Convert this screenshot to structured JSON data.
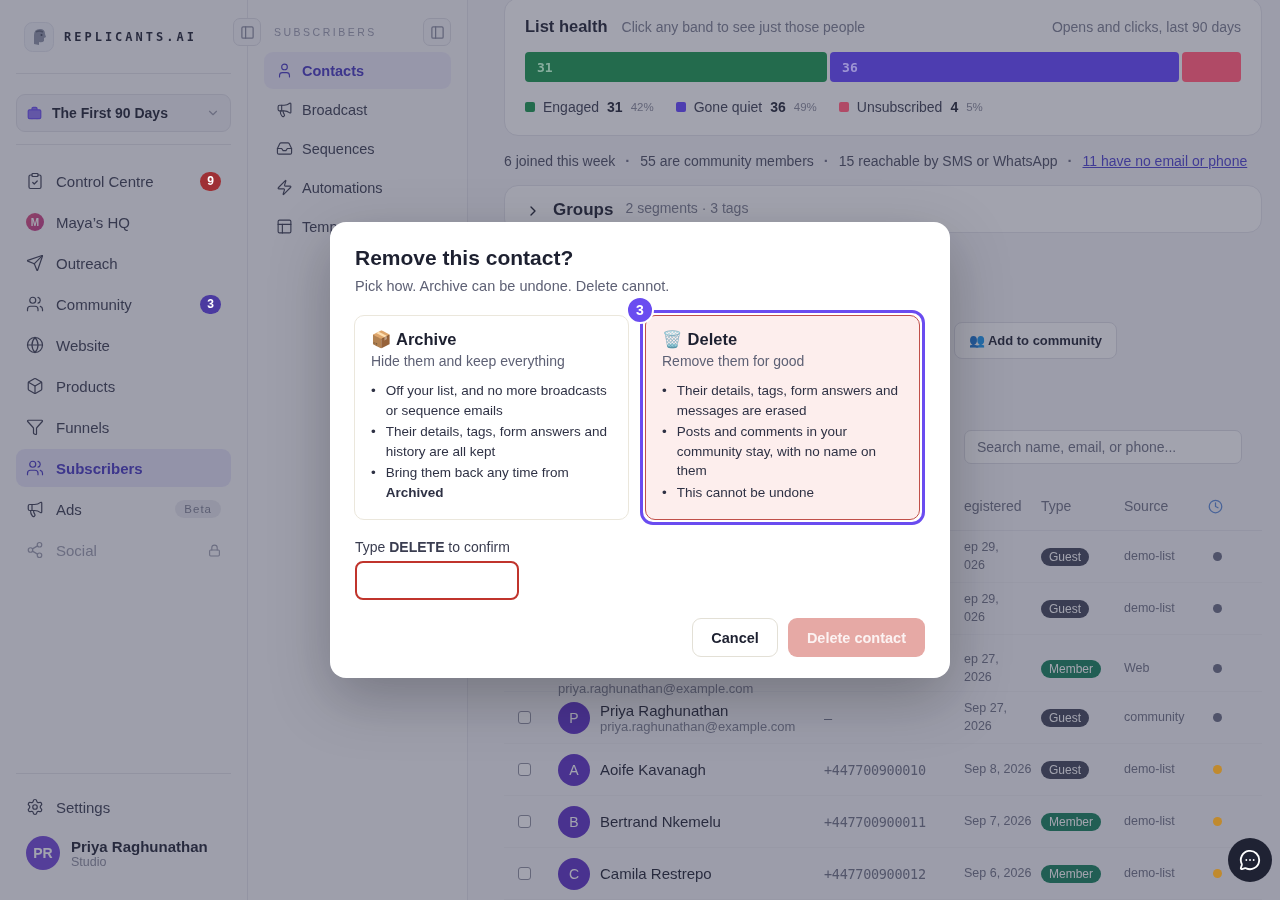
{
  "brand": {
    "name": "REPLICANTS.AI"
  },
  "workspace": {
    "name": "The First 90 Days"
  },
  "nav": [
    {
      "label": "Control Centre",
      "selected": false,
      "badge": "9",
      "color": "#9e3035"
    },
    {
      "label": "Maya’s HQ",
      "selected": false,
      "avatar": "M"
    },
    {
      "label": "Outreach",
      "selected": false
    },
    {
      "label": "Community",
      "selected": false,
      "badge": "3",
      "color": "#4b3aa0"
    },
    {
      "label": "Website",
      "selected": false
    },
    {
      "label": "Products",
      "selected": false
    },
    {
      "label": "Funnels",
      "selected": false
    },
    {
      "label": "Subscribers",
      "selected": true
    },
    {
      "label": "Ads",
      "selected": false,
      "tag": "Beta"
    },
    {
      "label": "Social",
      "selected": false,
      "locked": true
    }
  ],
  "footer_nav": [
    {
      "label": "Settings"
    }
  ],
  "user": {
    "initials": "PR",
    "name": "Priya Raghunathan",
    "plan": "Studio"
  },
  "subnav": {
    "heading": "SUBSCRIBERS",
    "items": [
      {
        "label": "Contacts",
        "selected": true
      },
      {
        "label": "Broadcast",
        "selected": false
      },
      {
        "label": "Sequences",
        "selected": false
      },
      {
        "label": "Automations",
        "selected": false
      },
      {
        "label": "Temp",
        "selected": false
      }
    ]
  },
  "list_health": {
    "title": "List health",
    "hint": "Click any band to see just those people",
    "period": "Opens and clicks, last 90 days",
    "bands": [
      {
        "name": "Engaged",
        "count": "31",
        "share": "42%",
        "label": "31",
        "color": "#236b4d"
      },
      {
        "name": "Gone quiet",
        "count": "36",
        "share": "49%",
        "label": "36",
        "color": "#4d3db0"
      },
      {
        "name": "Unsubscribed",
        "count": "4",
        "share": "5%",
        "color": "#b04a66"
      }
    ]
  },
  "stats": [
    {
      "text": "6 joined this week",
      "kind": "text"
    },
    {
      "text": "55 are community members",
      "kind": "text",
      "sep": "·"
    },
    {
      "text": "15 reachable by SMS or WhatsApp",
      "kind": "text",
      "sep": "·"
    },
    {
      "text": "11 have no email or phone",
      "kind": "link",
      "sep": "·"
    }
  ],
  "groups": {
    "title": "Groups",
    "meta": "2 segments · 3 tags",
    "expanded": false
  },
  "actions": [
    {
      "label": "👥 Add to community"
    }
  ],
  "search": {
    "placeholder": "Search name, email, or phone..."
  },
  "table": {
    "columns": [
      "egistered",
      "Type",
      "Source"
    ],
    "rows": [
      {
        "registered": "ep 29,",
        "registered_2": "026",
        "type": "Guest",
        "source": "demo-list",
        "color": "#50536a"
      },
      {
        "registered": "ep 29,",
        "registered_2": "026",
        "type": "Guest",
        "source": "demo-list",
        "color": "#50536a"
      },
      {
        "email": "priya.raghunathan@example.com",
        "registered": "ep 27,",
        "registered_2": "2026",
        "type": "Member",
        "source": "Web",
        "color": "#50536a"
      },
      {
        "initial": "P",
        "name": "Priya Raghunathan",
        "email": "priya.raghunathan@example.com",
        "phone": "–",
        "registered": "Sep 27,",
        "registered_2": "2026",
        "type": "Guest",
        "source": "community",
        "color": "#50536a",
        "checked": false
      },
      {
        "initial": "A",
        "name": "Aoife Kavanagh",
        "phone": "+447700900010",
        "registered": "Sep 8, 2026",
        "type": "Guest",
        "source": "demo-list",
        "color": "#c08a2e",
        "checked": false
      },
      {
        "initial": "B",
        "name": "Bertrand Nkemelu",
        "phone": "+447700900011",
        "registered": "Sep 7, 2026",
        "type": "Member",
        "source": "demo-list",
        "color": "#c08a2e",
        "checked": false
      },
      {
        "initial": "C",
        "name": "Camila Restrepo",
        "phone": "+447700900012",
        "registered": "Sep 6, 2026",
        "type": "Member",
        "source": "demo-list",
        "color": "#c08a2e",
        "checked": false
      }
    ]
  },
  "modal": {
    "title": "Remove this contact?",
    "subtitle": "Pick how. Archive can be undone. Delete cannot.",
    "options": [
      {
        "title": "📦 Archive",
        "subtitle": "Hide them and keep everything",
        "kind": "archive",
        "selected": false,
        "bullet": "•",
        "points": [
          "Off your list, and no more broadcasts or sequence emails",
          "Their details, tags, form answers and history are all kept",
          "Bring them back any time from **Archived**"
        ]
      },
      {
        "title": "🗑️ Delete",
        "subtitle": "Remove them for good",
        "kind": "delete",
        "selected": true,
        "step": "3",
        "bullet": "•",
        "points": [
          "Their details, tags, form answers and messages are erased",
          "Posts and comments in your community stay, with no name on them",
          "This cannot be undone"
        ]
      }
    ],
    "confirm_label": "Type **DELETE** to confirm",
    "confirm_invalid": true,
    "cancel": "Cancel",
    "submit": "Delete contact",
    "submit_disabled": true
  }
}
